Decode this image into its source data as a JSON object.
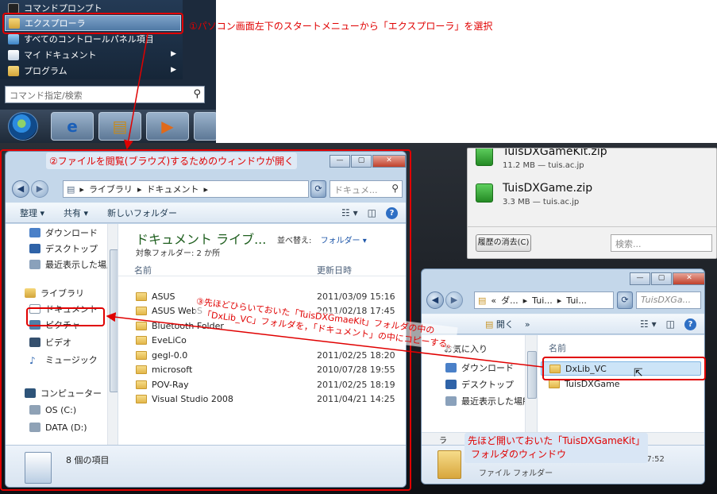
{
  "start_menu": {
    "items": [
      {
        "label": "コマンドプロンプト",
        "icon": "console-icon"
      },
      {
        "label": "エクスプローラ",
        "icon": "explorer-icon"
      },
      {
        "label": "すべてのコントロールパネル項目",
        "icon": "control-panel-icon"
      },
      {
        "label": "マイ ドキュメント",
        "icon": "documents-icon"
      },
      {
        "label": "プログラム",
        "icon": "programs-icon"
      }
    ],
    "search_placeholder": "コマンド指定/検索"
  },
  "annotations": {
    "step1": "①パソコン画面左下のスタートメニューから「エクスプローラ」を選択",
    "step2": "②ファイルを閲覧(ブラウズ)するためのウィンドウが開く",
    "step3_line1": "③先ほどひらいておいた「TuisDXGmaeKit」フォルダの中の",
    "step3_line2": "「DxLib_VC」フォルダを，「ドキュメント」の中にコピーする。",
    "caption_line1": "先ほど開いておいた「TuisDXGameKit」",
    "caption_line2": "フォルダのウィンドウ"
  },
  "explorer": {
    "breadcrumb": [
      "ライブラリ",
      "ドキュメント"
    ],
    "search_placeholder": "ドキュメ...",
    "commands": [
      "整理",
      "共有",
      "新しいフォルダー"
    ],
    "library_title": "ドキュメント ライブ...",
    "target_folders": "対象フォルダー: 2 か所",
    "arrange_label": "並べ替え:",
    "arrange_value": "フォルダー",
    "col_name": "名前",
    "col_date": "更新日時",
    "nav": {
      "favorites": [
        "ダウンロード",
        "デスクトップ",
        "最近表示した場所"
      ],
      "library_header": "ライブラリ",
      "libraries": [
        "ドキュメント",
        "ピクチャ",
        "ビデオ",
        "ミュージック"
      ],
      "computer_header": "コンピューター",
      "drives": [
        "OS (C:)",
        "DATA (D:)"
      ]
    },
    "files": [
      {
        "name": "ASUS",
        "date": "2011/03/09 15:16"
      },
      {
        "name": "ASUS WebS",
        "date": "2011/02/18 17:45"
      },
      {
        "name": "Bluetooth Folder",
        "date": ""
      },
      {
        "name": "EveLiCo",
        "date": ""
      },
      {
        "name": "gegl-0.0",
        "date": "2011/02/25 18:20"
      },
      {
        "name": "microsoft",
        "date": "2010/07/28 19:55"
      },
      {
        "name": "POV-Ray",
        "date": "2011/02/25 18:19"
      },
      {
        "name": "Visual Studio 2008",
        "date": "2011/04/21 14:25"
      }
    ],
    "item_count": "8 個の項目"
  },
  "kit_window": {
    "breadcrumb": [
      "«",
      "ダ...",
      "Tui...",
      "Tui..."
    ],
    "search_placeholder": "TuisDXGa...",
    "open_label": "開く",
    "more_label": "»",
    "col_name": "名前",
    "nav": [
      "お気に入り",
      "ダウンロード",
      "デスクトップ",
      "最近表示した場所"
    ],
    "nav_bottom": "ラ",
    "files": [
      "DxLib_VC",
      "TuisDXGame"
    ],
    "status_date": "日時: 2011/04/28 7:52",
    "status_type": "ファイル フォルダー"
  },
  "downloads": {
    "items": [
      {
        "name": "TuisDXGameKit.zip",
        "meta": "11.2 MB — tuis.ac.jp"
      },
      {
        "name": "TuisDXGame.zip",
        "meta": "3.3 MB — tuis.ac.jp"
      }
    ],
    "clear_button": "履歴の消去(C)",
    "search_placeholder": "検索..."
  },
  "colors": {
    "annotation": "#e00000",
    "selection": "#cce4f7",
    "accent": "#2a7d2a"
  }
}
